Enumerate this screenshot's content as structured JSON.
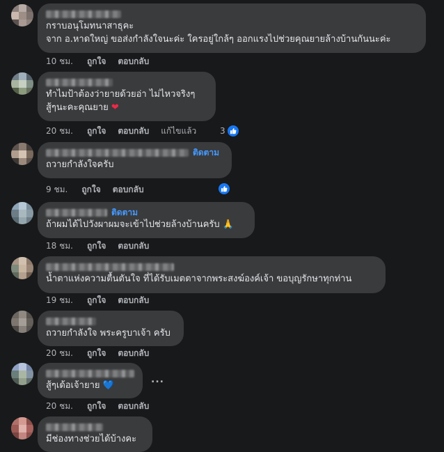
{
  "labels": {
    "like": "ถูกใจ",
    "reply": "ตอบกลับ",
    "edited": "แก้ไขแล้ว",
    "follow": "ติดตาม"
  },
  "comments": [
    {
      "lines": [
        "กราบอนุโมทนาสาธุคะ",
        "จาก อ.หาดใหญ่ ขอส่งกำลังใจนะค่ะ ใครอยู่ใกล้ๆ ออกแรงไปช่วยคุณยายล้างบ้านกันนะค่ะ"
      ],
      "time": "10 ชม."
    },
    {
      "lines": [
        "ทำไมป้าต้องว่ายายด้วยอ่า ไม่ไหวจริงๆ",
        "สู้ๆนะคะคุณยาย"
      ],
      "emoji": "❤",
      "time": "20 ชม.",
      "reaction_count": "3"
    },
    {
      "lines": [
        "ถวายกำลังใจครับ"
      ],
      "time": "9 ชม."
    },
    {
      "lines": [
        "ถ้าผมได้ไปวังผาผมจะเข้าไปช่วยล้างบ้านครับ"
      ],
      "emoji": "🙏",
      "time": "18 ชม."
    },
    {
      "lines": [
        "น้ำตาแห่งความตื้นตันใจ ที่ได้รับเมตตาจากพระสงฆ์องค์เจ้า ขอบุญรักษาทุกท่าน"
      ],
      "time": "19 ชม."
    },
    {
      "lines": [
        "ถวายกำลังใจ พระครูบาเจ้า ครับ"
      ],
      "time": "20 ชม."
    },
    {
      "lines": [
        "สู้ๆเด้อเจ้ายาย"
      ],
      "emoji": "💙",
      "time": "20 ชม.",
      "more": "..."
    },
    {
      "lines": [
        "มีช่องทางช่วยได้บ้างคะ"
      ]
    }
  ]
}
